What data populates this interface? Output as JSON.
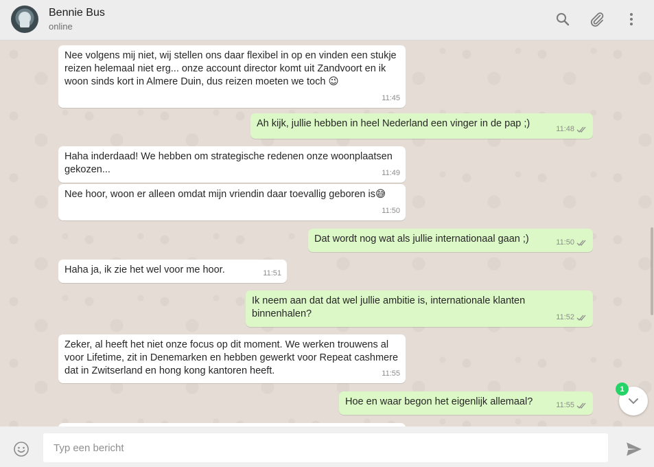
{
  "header": {
    "contact_name": "Bennie Bus",
    "contact_status": "online",
    "icons": [
      "search-icon",
      "paperclip-icon",
      "more-vertical-icon"
    ]
  },
  "messages": [
    {
      "direction": "in",
      "text": "Nee volgens mij niet, wij stellen ons daar flexibel in op en vinden een stukje reizen helemaal niet erg... onze account director komt uit Zandvoort en ik woon sinds kort in Almere Duin, dus reizen moeten we toch 😉",
      "time": "11:45"
    },
    {
      "direction": "out",
      "text": "Ah kijk, jullie hebben in heel Nederland een vinger in de pap ;)",
      "time": "11:48",
      "status": "read"
    },
    {
      "direction": "in",
      "text": "Haha inderdaad! We hebben om strategische redenen onze woonplaatsen gekozen...",
      "time": "11:49"
    },
    {
      "direction": "in",
      "text": "Nee hoor, woon er alleen omdat mijn vriendin daar toevallig geboren is😅",
      "time": "11:50"
    },
    {
      "direction": "out",
      "text": "Dat wordt nog wat als jullie internationaal gaan ;)",
      "time": "11:50",
      "status": "read"
    },
    {
      "direction": "in",
      "text": "Haha ja, ik zie het wel voor me hoor.",
      "time": "11:51"
    },
    {
      "direction": "out",
      "text": "Ik neem aan dat dat wel jullie ambitie is, internationale klanten binnenhalen?",
      "time": "11:52",
      "status": "read"
    },
    {
      "direction": "in",
      "text": "Zeker, al heeft het niet onze focus op dit moment. We werken trouwens al voor Lifetime, zit in Denemarken en hebben gewerkt voor Repeat cashmere dat in Zwitserland en hong kong kantoren heeft.",
      "time": "11:55"
    },
    {
      "direction": "out",
      "text": "Hoe en waar begon het eigenlijk allemaal?",
      "time": "11:55",
      "status": "read"
    }
  ],
  "scroll_down": {
    "unread_count": "1"
  },
  "composer": {
    "placeholder": "Typ een bericht"
  },
  "colors": {
    "incoming": "#ffffff",
    "outgoing": "#dcf8c6",
    "badge": "#25d366",
    "chat_bg": "#e5ddd5"
  }
}
